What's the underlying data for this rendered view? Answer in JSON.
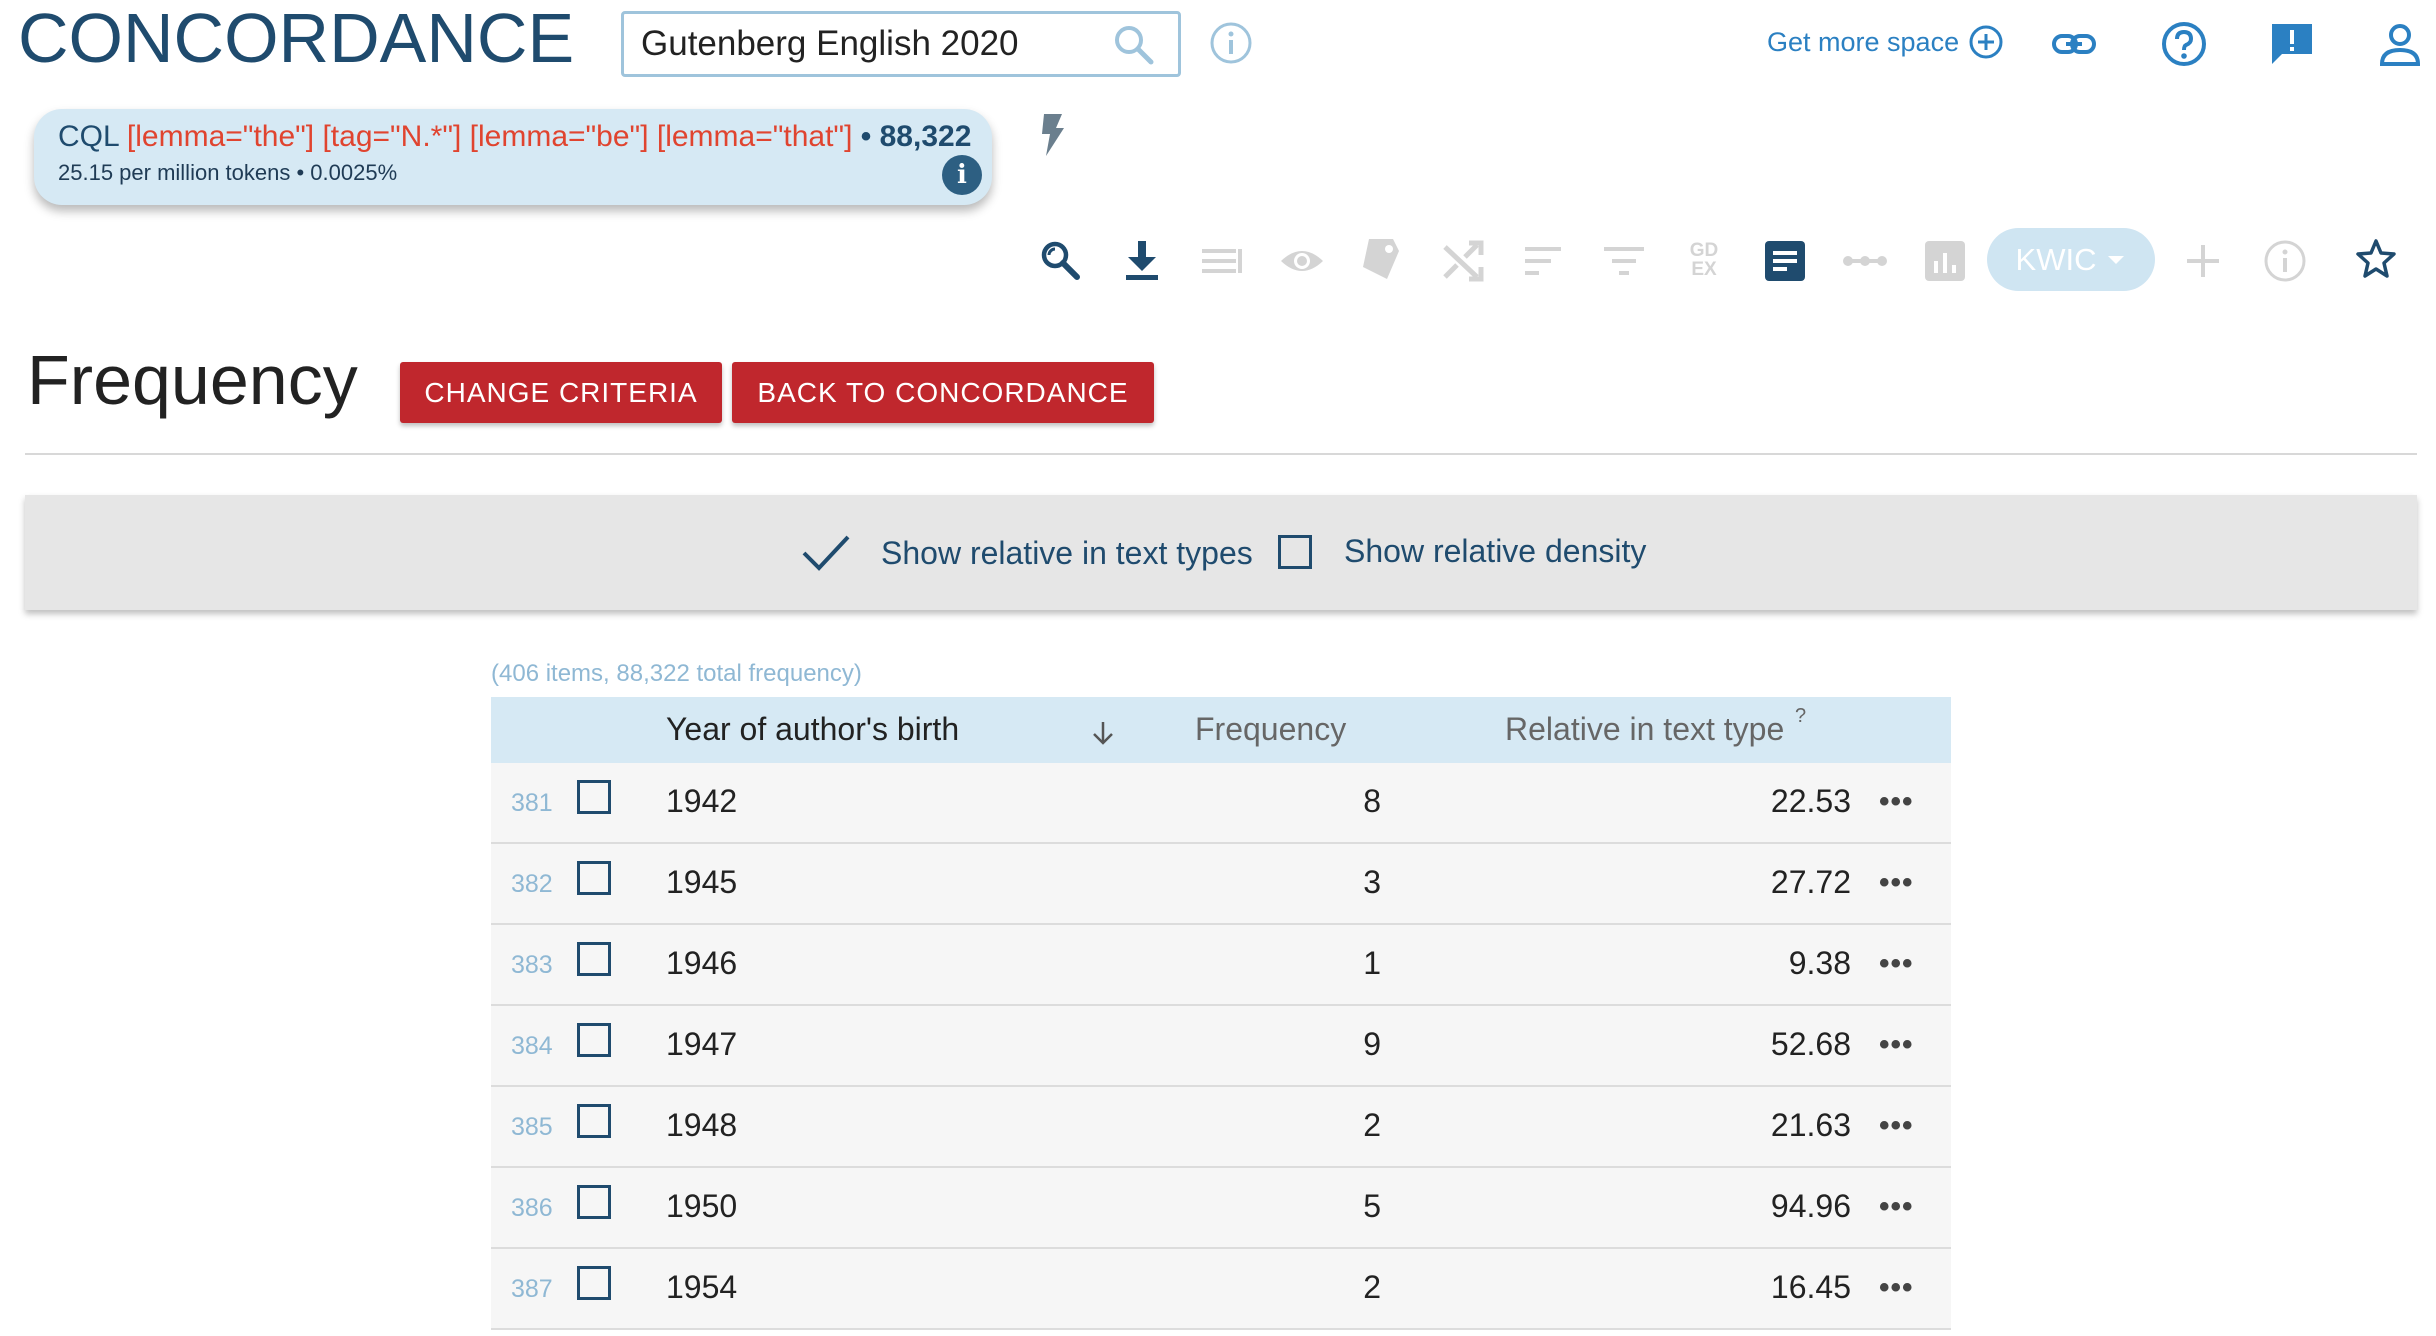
{
  "app": {
    "title": "CONCORDANCE"
  },
  "corpus": {
    "name": "Gutenberg English 2020"
  },
  "header": {
    "get_more_space": "Get more space"
  },
  "cql": {
    "label": "CQL",
    "query": "[lemma=\"the\"] [tag=\"N.*\"] [lemma=\"be\"] [lemma=\"that\"]",
    "separator": "•",
    "count": "88,322",
    "stats": "25.15 per million tokens • 0.0025%"
  },
  "toolbar": {
    "kwic_label": "KWIC",
    "gdex_label": "GD EX"
  },
  "page": {
    "heading": "Frequency",
    "change_criteria": "CHANGE CRITERIA",
    "back_to_concordance": "BACK TO CONCORDANCE"
  },
  "options": {
    "show_relative_text_types": "Show relative in text types",
    "show_relative_density": "Show relative density"
  },
  "table": {
    "summary": "(406 items, 88,322 total frequency)",
    "columns": {
      "year": "Year of author's birth",
      "frequency": "Frequency",
      "relative": "Relative in text type",
      "relative_help": "?"
    },
    "rows": [
      {
        "num": "381",
        "year": "1942",
        "frequency": "8",
        "relative": "22.53"
      },
      {
        "num": "382",
        "year": "1945",
        "frequency": "3",
        "relative": "27.72"
      },
      {
        "num": "383",
        "year": "1946",
        "frequency": "1",
        "relative": "9.38"
      },
      {
        "num": "384",
        "year": "1947",
        "frequency": "9",
        "relative": "52.68"
      },
      {
        "num": "385",
        "year": "1948",
        "frequency": "2",
        "relative": "21.63"
      },
      {
        "num": "386",
        "year": "1950",
        "frequency": "5",
        "relative": "94.96"
      },
      {
        "num": "387",
        "year": "1954",
        "frequency": "2",
        "relative": "16.45"
      }
    ],
    "more_glyph": "•••"
  },
  "colors": {
    "brand": "#1f4b6e",
    "accent_link": "#2b80c2",
    "query_red": "#e0442f",
    "button_red": "#c0272d",
    "chip_bg": "#d6e9f4"
  }
}
